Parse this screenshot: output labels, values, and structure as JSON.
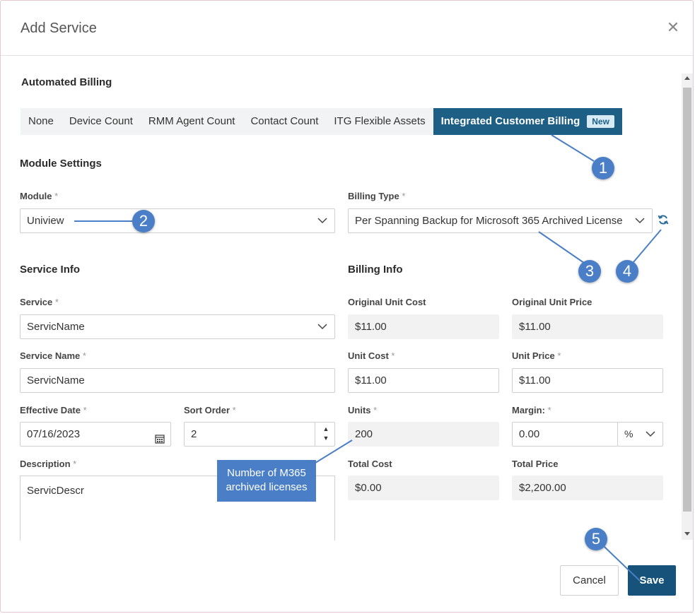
{
  "dialog": {
    "title": "Add Service"
  },
  "automated_billing": {
    "heading": "Automated Billing",
    "tabs": [
      {
        "label": "None"
      },
      {
        "label": "Device Count"
      },
      {
        "label": "RMM Agent Count"
      },
      {
        "label": "Contact Count"
      },
      {
        "label": "ITG Flexible Assets"
      },
      {
        "label": "Integrated Customer Billing",
        "badge": "New",
        "active": true
      }
    ]
  },
  "module_settings": {
    "heading": "Module Settings",
    "module_label": "Module",
    "module_value": "Uniview",
    "billing_type_label": "Billing Type",
    "billing_type_value": "Per Spanning Backup for Microsoft 365 Archived License"
  },
  "service_info": {
    "heading": "Service Info",
    "service_label": "Service",
    "service_value": "ServicName",
    "service_name_label": "Service Name",
    "service_name_value": "ServicName",
    "effective_date_label": "Effective Date",
    "effective_date_value": "07/16/2023",
    "sort_order_label": "Sort Order",
    "sort_order_value": "2",
    "description_label": "Description",
    "description_value": "ServicDescr"
  },
  "billing_info": {
    "heading": "Billing Info",
    "original_unit_cost_label": "Original Unit Cost",
    "original_unit_cost_value": "$11.00",
    "original_unit_price_label": "Original Unit Price",
    "original_unit_price_value": "$11.00",
    "unit_cost_label": "Unit Cost",
    "unit_cost_value": "$11.00",
    "unit_price_label": "Unit Price",
    "unit_price_value": "$11.00",
    "units_label": "Units",
    "units_value": "200",
    "margin_label": "Margin:",
    "margin_value": "0.00",
    "margin_unit": "%",
    "total_cost_label": "Total Cost",
    "total_cost_value": "$0.00",
    "total_price_label": "Total Price",
    "total_price_value": "$2,200.00"
  },
  "required_mark": "*",
  "buttons": {
    "cancel": "Cancel",
    "save": "Save"
  },
  "annotations": {
    "callouts": [
      "1",
      "2",
      "3",
      "4",
      "5"
    ],
    "note": "Number of M365 archived licenses"
  },
  "colors": {
    "accent": "#1e5f86",
    "callout": "#4a7fc8",
    "save": "#16527a"
  }
}
